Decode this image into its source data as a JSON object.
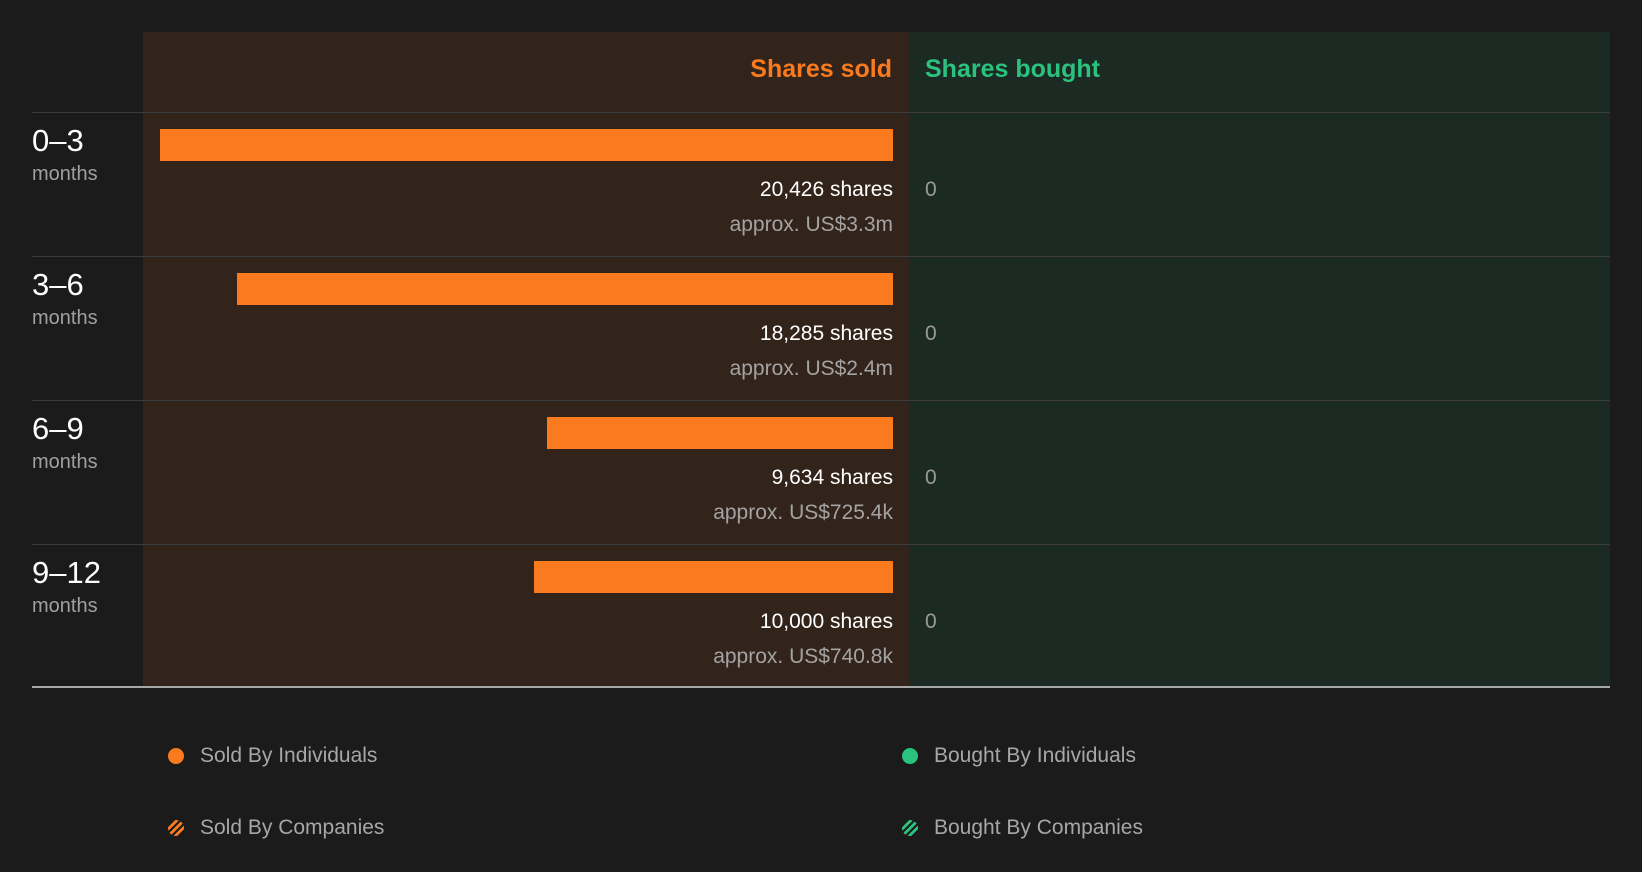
{
  "colors": {
    "sold": "#f97a1f",
    "bought": "#2bc27d",
    "sold_bg": "#33241b",
    "bought_bg": "#1c2a24"
  },
  "chart_data": {
    "type": "bar",
    "orientation": "horizontal",
    "headers": {
      "sold": "Shares sold",
      "bought": "Shares bought"
    },
    "categories": [
      {
        "range": "0–3",
        "unit": "months"
      },
      {
        "range": "3–6",
        "unit": "months"
      },
      {
        "range": "6–9",
        "unit": "months"
      },
      {
        "range": "9–12",
        "unit": "months"
      }
    ],
    "series": [
      {
        "name": "Sold By Individuals",
        "values": [
          20426,
          18285,
          9634,
          10000
        ],
        "labels": [
          "20,426 shares",
          "18,285 shares",
          "9,634 shares",
          "10,000 shares"
        ],
        "value_labels": [
          "approx. US$3.3m",
          "approx. US$2.4m",
          "approx. US$725.4k",
          "approx. US$740.8k"
        ]
      },
      {
        "name": "Bought By Individuals",
        "values": [
          0,
          0,
          0,
          0
        ],
        "labels": [
          "0",
          "0",
          "0",
          "0"
        ]
      }
    ],
    "legend": [
      {
        "label": "Sold By Individuals",
        "style": "solid",
        "color": "#f97a1f"
      },
      {
        "label": "Bought By Individuals",
        "style": "solid",
        "color": "#2bc27d"
      },
      {
        "label": "Sold By Companies",
        "style": "striped",
        "color": "#f97a1f"
      },
      {
        "label": "Bought By Companies",
        "style": "striped",
        "color": "#2bc27d"
      }
    ],
    "legend_position": "bottom"
  }
}
